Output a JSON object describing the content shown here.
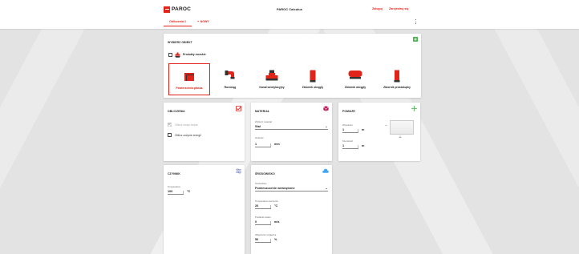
{
  "header": {
    "logo_text": "PAROC",
    "app_title": "PAROC Calculus",
    "login_label": "Zaloguj",
    "register_label": "Zarejestruj się",
    "brand_color": "#e2231a"
  },
  "tabs": [
    {
      "label": "Obliczenia 1",
      "active": true
    },
    {
      "label": "NOWY",
      "prefix": "+",
      "active": false
    }
  ],
  "object_card": {
    "title": "WYBIERZ OBIEKT",
    "icon": "add-icon",
    "marine_checkbox": {
      "label": "Produkty morskie",
      "checked": false
    },
    "products": [
      {
        "label": "Powierzchnia płaska",
        "icon": "flat-surface-icon",
        "active": true
      },
      {
        "label": "Rurociąg",
        "icon": "pipeline-icon",
        "active": false
      },
      {
        "label": "Kanał wentylacyjny",
        "icon": "ventilation-duct-icon",
        "active": false
      },
      {
        "label": "Zbiornik okrągły",
        "icon": "round-tank-vertical-icon",
        "active": false
      },
      {
        "label": "Zbiornik okrągły",
        "icon": "round-tank-horizontal-icon",
        "active": false
      },
      {
        "label": "Zbiornik prostokątny",
        "icon": "rectangular-tank-icon",
        "active": false
      }
    ]
  },
  "calc_card": {
    "title": "OBLICZENIA",
    "icon": "check-icon",
    "options": [
      {
        "label": "Oblicz straty ciepła",
        "checked": true,
        "disabled": true
      },
      {
        "label": "Oblicz zużycie energii",
        "checked": false,
        "disabled": false
      }
    ]
  },
  "material_card": {
    "title": "MATERIAŁ",
    "icon": "cube-icon",
    "material_label": "Wybierz materiał",
    "material_value": "Stal",
    "thickness_label": "Grubość",
    "thickness_value": "1",
    "thickness_unit": "mm"
  },
  "dimensions_card": {
    "title": "POMIARY",
    "icon": "move-icon",
    "height_label": "Wysokość",
    "height_value": "1",
    "height_unit": "m",
    "width_label": "Szerokość",
    "width_value": "1",
    "width_unit": "m"
  },
  "medium_card": {
    "title": "CZYNNIK",
    "icon": "layers-icon",
    "temperature_label": "Temperatura",
    "temperature_value": "100",
    "temperature_unit": "°C"
  },
  "environment_card": {
    "title": "ŚRODOWISKO",
    "icon": "cloud-icon",
    "environment_label": "Środowisko",
    "environment_value": "Pomieszczenie wewnętrzne",
    "ambient_temp_label": "Temperatura otoczenia",
    "ambient_temp_value": "20",
    "ambient_temp_unit": "°C",
    "wind_label": "Prędkość wiatru",
    "wind_value": "0",
    "wind_unit": "m/s",
    "humidity_label": "Wilgotność względna",
    "humidity_value": "50",
    "humidity_unit": "%"
  }
}
